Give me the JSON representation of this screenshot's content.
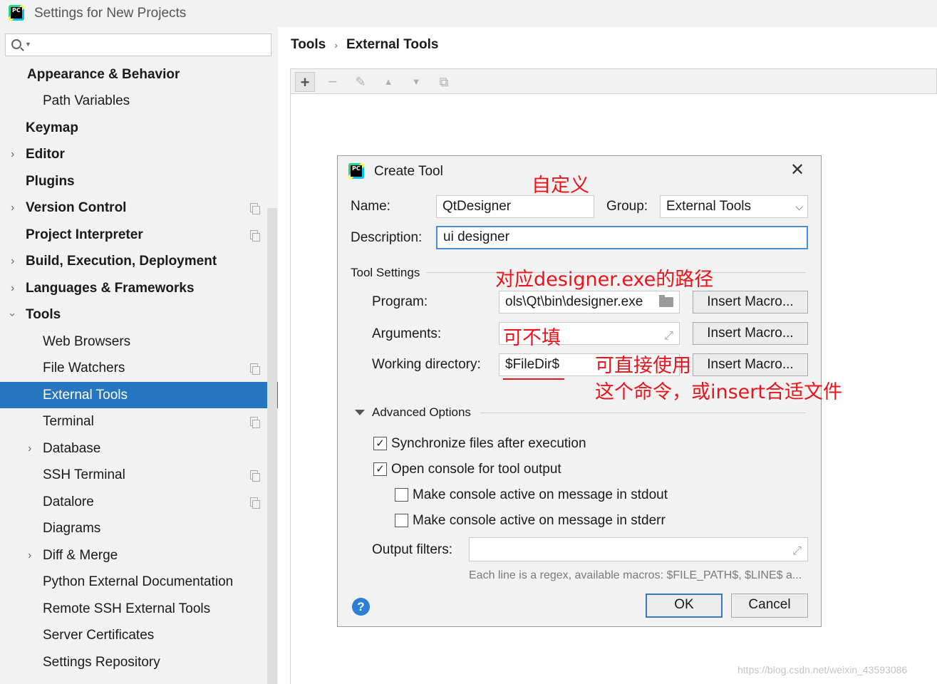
{
  "window": {
    "title": "Settings for New Projects",
    "logo_text": "PC"
  },
  "sidebar": {
    "search_placeholder": "",
    "items": [
      {
        "label": "Appearance & Behavior",
        "bold": true
      },
      {
        "label": "Path Variables"
      },
      {
        "label": "Keymap",
        "bold": true
      },
      {
        "label": "Editor",
        "bold": true
      },
      {
        "label": "Plugins",
        "bold": true
      },
      {
        "label": "Version Control",
        "bold": true
      },
      {
        "label": "Project Interpreter",
        "bold": true
      },
      {
        "label": "Build, Execution, Deployment",
        "bold": true
      },
      {
        "label": "Languages & Frameworks",
        "bold": true
      },
      {
        "label": "Tools",
        "bold": true
      },
      {
        "label": "Web Browsers"
      },
      {
        "label": "File Watchers"
      },
      {
        "label": "External Tools",
        "selected": true
      },
      {
        "label": "Terminal"
      },
      {
        "label": "Database"
      },
      {
        "label": "SSH Terminal"
      },
      {
        "label": "Datalore"
      },
      {
        "label": "Diagrams"
      },
      {
        "label": "Diff & Merge"
      },
      {
        "label": "Python External Documentation"
      },
      {
        "label": "Remote SSH External Tools"
      },
      {
        "label": "Server Certificates"
      },
      {
        "label": "Settings Repository"
      }
    ]
  },
  "breadcrumb": {
    "parent": "Tools",
    "current": "External Tools",
    "separator": "›"
  },
  "toolbar": {
    "add": "+",
    "remove": "−",
    "edit": "✎",
    "up": "▲",
    "down": "▼",
    "copy": "⧉"
  },
  "dialog": {
    "title": "Create Tool",
    "logo_text": "PC",
    "close": "✕",
    "name_label": "Name:",
    "name_value": "QtDesigner",
    "group_label": "Group:",
    "group_value": "External Tools",
    "description_label": "Description:",
    "description_value": "ui designer",
    "tool_settings_label": "Tool Settings",
    "program_label": "Program:",
    "program_value": "ols\\Qt\\bin\\designer.exe",
    "arguments_label": "Arguments:",
    "arguments_value": "",
    "working_dir_label": "Working directory:",
    "working_dir_value": "$FileDir$",
    "insert_macro": "Insert Macro...",
    "advanced_label": "Advanced Options",
    "checkboxes": [
      {
        "label": "Synchronize files after execution",
        "checked": true
      },
      {
        "label": "Open console for tool output",
        "checked": true
      },
      {
        "label": "Make console active on message in stdout",
        "checked": false
      },
      {
        "label": "Make console active on message in stderr",
        "checked": false
      }
    ],
    "output_filters_label": "Output filters:",
    "output_filters_value": "",
    "hint": "Each line is a regex, available macros: $FILE_PATH$, $LINE$ a...",
    "help": "?",
    "ok": "OK",
    "cancel": "Cancel"
  },
  "annotations": {
    "name_note": "自定义",
    "program_note": "对应designer.exe的路径",
    "arguments_note": "可不填",
    "workdir_note_1": "可直接使用",
    "workdir_note_2": "这个命令，或insert合适文件",
    "color": "#e8161c"
  },
  "watermark": "https://blog.csdn.net/weixin_43593086"
}
